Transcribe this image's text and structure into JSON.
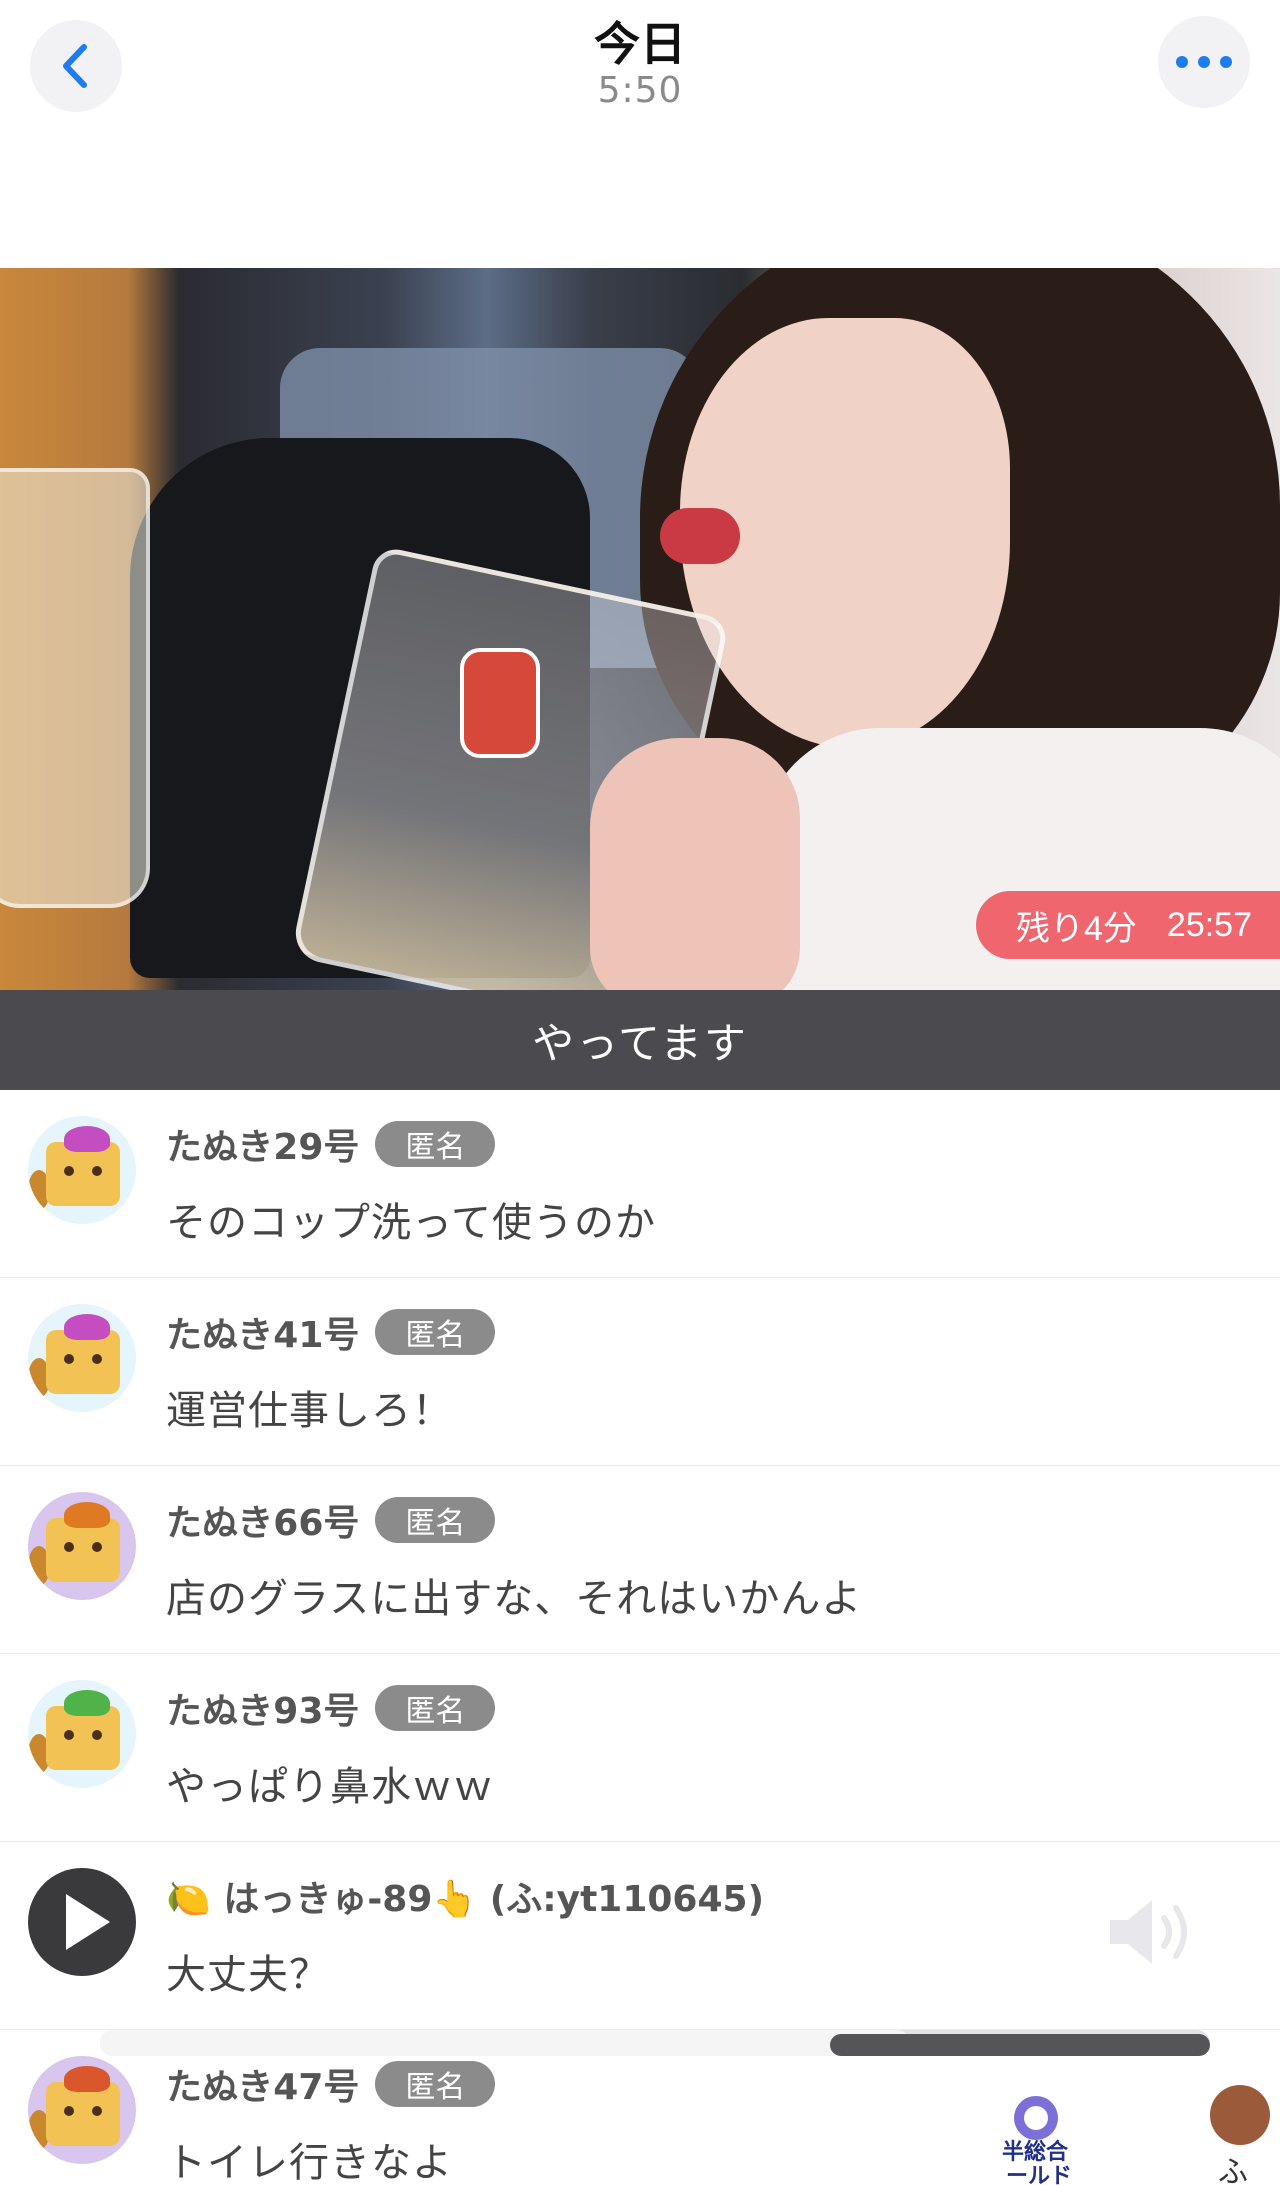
{
  "header": {
    "title": "今日",
    "time": "5:50",
    "back_icon": "chevron-left-icon",
    "more_icon": "ellipsis-icon",
    "accent_color": "#1e7cf2"
  },
  "video": {
    "timer_label": "残り4分",
    "timer_value": "25:57",
    "timer_color": "#f05a64"
  },
  "caption": "やってます",
  "comments": [
    {
      "name": "たぬき29号",
      "badge": "匿名",
      "text": "そのコップ洗って使うのか"
    },
    {
      "name": "たぬき41号",
      "badge": "匿名",
      "text": "運営仕事しろ！"
    },
    {
      "name": "たぬき66号",
      "badge": "匿名",
      "text": "店のグラスに出すな、それはいかんよ"
    },
    {
      "name": "たぬき93号",
      "badge": "匿名",
      "text": "やっぱり鼻水ｗｗ"
    },
    {
      "name": "🍋 はっきゅ-89👆 (ふ:yt110645)",
      "text": "大丈夫？"
    },
    {
      "name": "たぬき47号",
      "badge": "匿名",
      "text": "トイレ行きなよ"
    }
  ],
  "media_controls": {
    "speaker_icon": "speaker-icon",
    "play_icon": "play-icon",
    "progress": 0.73
  },
  "logos": {
    "left_line1": "半総合",
    "left_line2": "ールド",
    "right_char": "ふ"
  }
}
